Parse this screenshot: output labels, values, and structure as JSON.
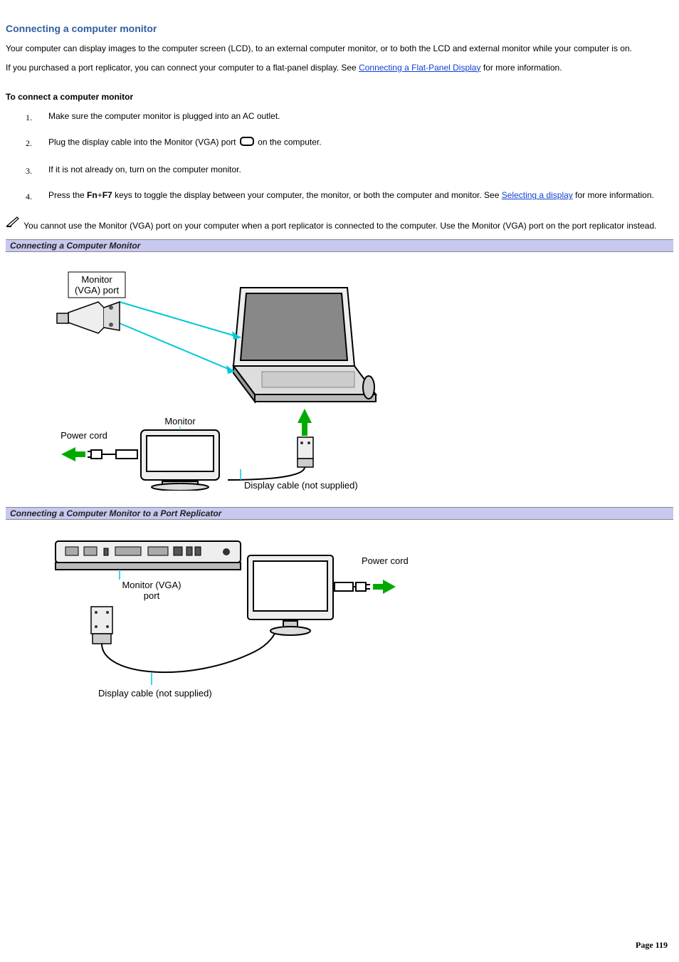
{
  "title": "Connecting a computer monitor",
  "para1": "Your computer can display images to the computer screen (LCD), to an external computer monitor, or to both the LCD and external monitor while your computer is on.",
  "para2_pre": "If you purchased a port replicator, you can connect your computer to a flat-panel display. See ",
  "para2_link": "Connecting a Flat-Panel Display",
  "para2_post": " for more information.",
  "subheading": "To connect a computer monitor",
  "steps": {
    "n1": "1.",
    "s1": "Make sure the computer monitor is plugged into an AC outlet.",
    "n2": "2.",
    "s2_pre": "Plug the display cable into the Monitor (VGA) port ",
    "s2_post": " on the computer.",
    "n3": "3.",
    "s3": "If it is not already on, turn on the computer monitor.",
    "n4": "4.",
    "s4_pre": "Press the ",
    "s4_key1": "Fn",
    "s4_plus": "+",
    "s4_key2": "F7",
    "s4_mid": " keys to toggle the display between your computer, the monitor, or both the computer and monitor. See ",
    "s4_link": "Selecting a display",
    "s4_post": " for more information."
  },
  "note": "You cannot use the Monitor (VGA) port on your computer when a port replicator is connected to the computer. Use the Monitor (VGA) port on the port replicator instead.",
  "figure1": {
    "caption": "Connecting a Computer Monitor",
    "label_vga": "Monitor\n(VGA) port",
    "label_monitor": "Monitor",
    "label_power": "Power cord",
    "label_cable": "Display cable (not supplied)"
  },
  "figure2": {
    "caption": "Connecting a Computer Monitor to a Port Replicator",
    "label_vga": "Monitor (VGA)\nport",
    "label_power": "Power cord",
    "label_cable": "Display cable (not supplied)"
  },
  "page_number": "Page 119"
}
